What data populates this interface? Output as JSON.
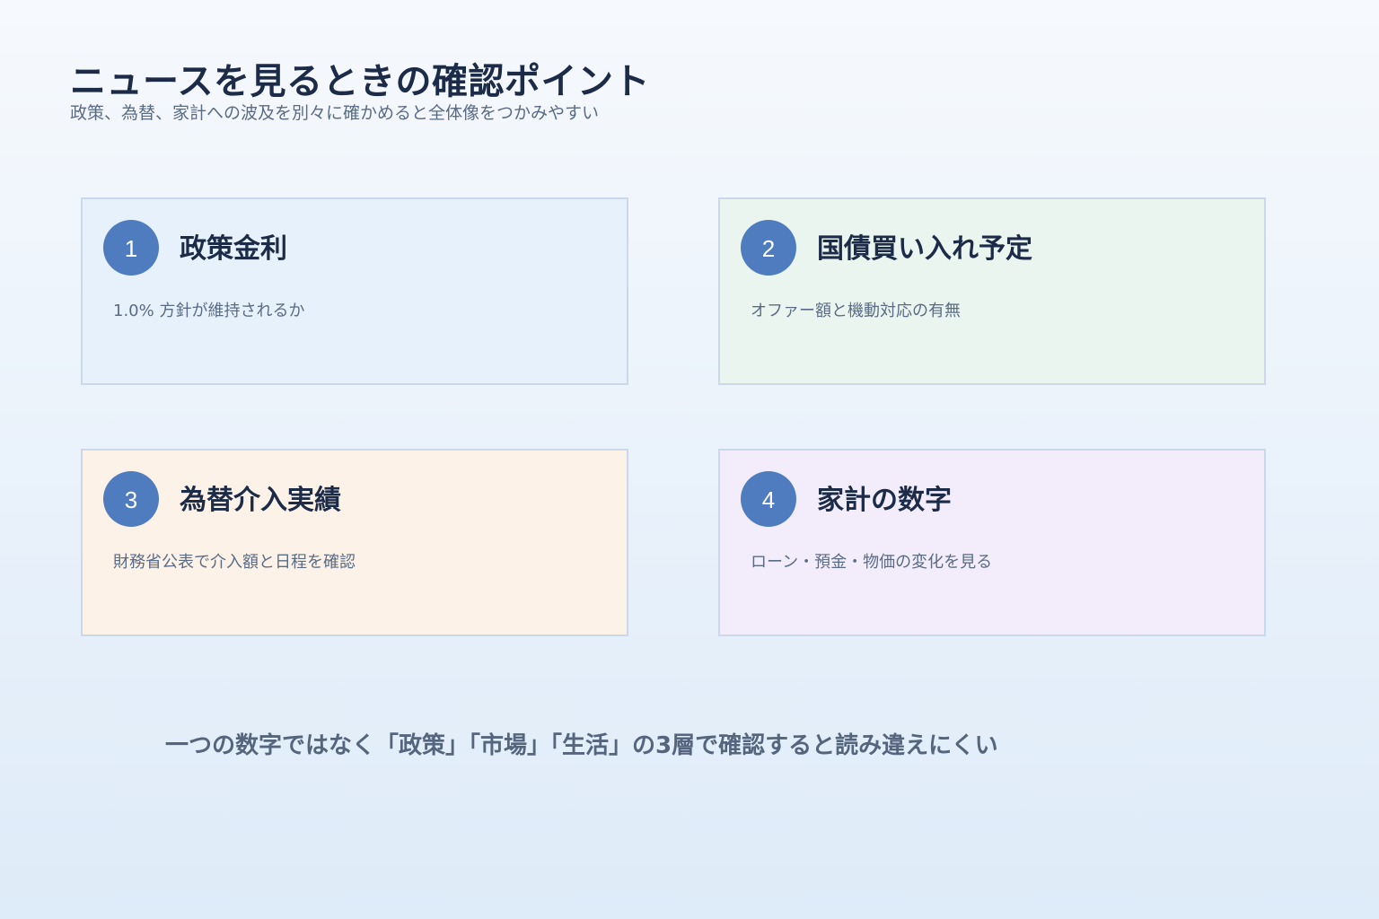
{
  "header": {
    "title": "ニュースを見るときの確認ポイント",
    "subtitle": "政策、為替、家計への波及を別々に確かめると全体像をつかみやすい"
  },
  "cards": [
    {
      "number": "1",
      "title": "政策金利",
      "description": "1.0% 方針が維持されるか",
      "background": "#e7f1fc"
    },
    {
      "number": "2",
      "title": "国債買い入れ予定",
      "description": "オファー額と機動対応の有無",
      "background": "#ebf5ef"
    },
    {
      "number": "3",
      "title": "為替介入実績",
      "description": "財務省公表で介入額と日程を確認",
      "background": "#fdf2e8"
    },
    {
      "number": "4",
      "title": "家計の数字",
      "description": "ローン・預金・物価の変化を見る",
      "background": "#f3edfb"
    }
  ],
  "footer": {
    "note": "一つの数字ではなく「政策」「市場」「生活」の3層で確認すると読み違えにくい"
  },
  "colors": {
    "badge": "#4e7cbf",
    "title_text": "#1c2b47",
    "muted_text": "#5a6b85",
    "card_border": "#c9d8ea"
  }
}
